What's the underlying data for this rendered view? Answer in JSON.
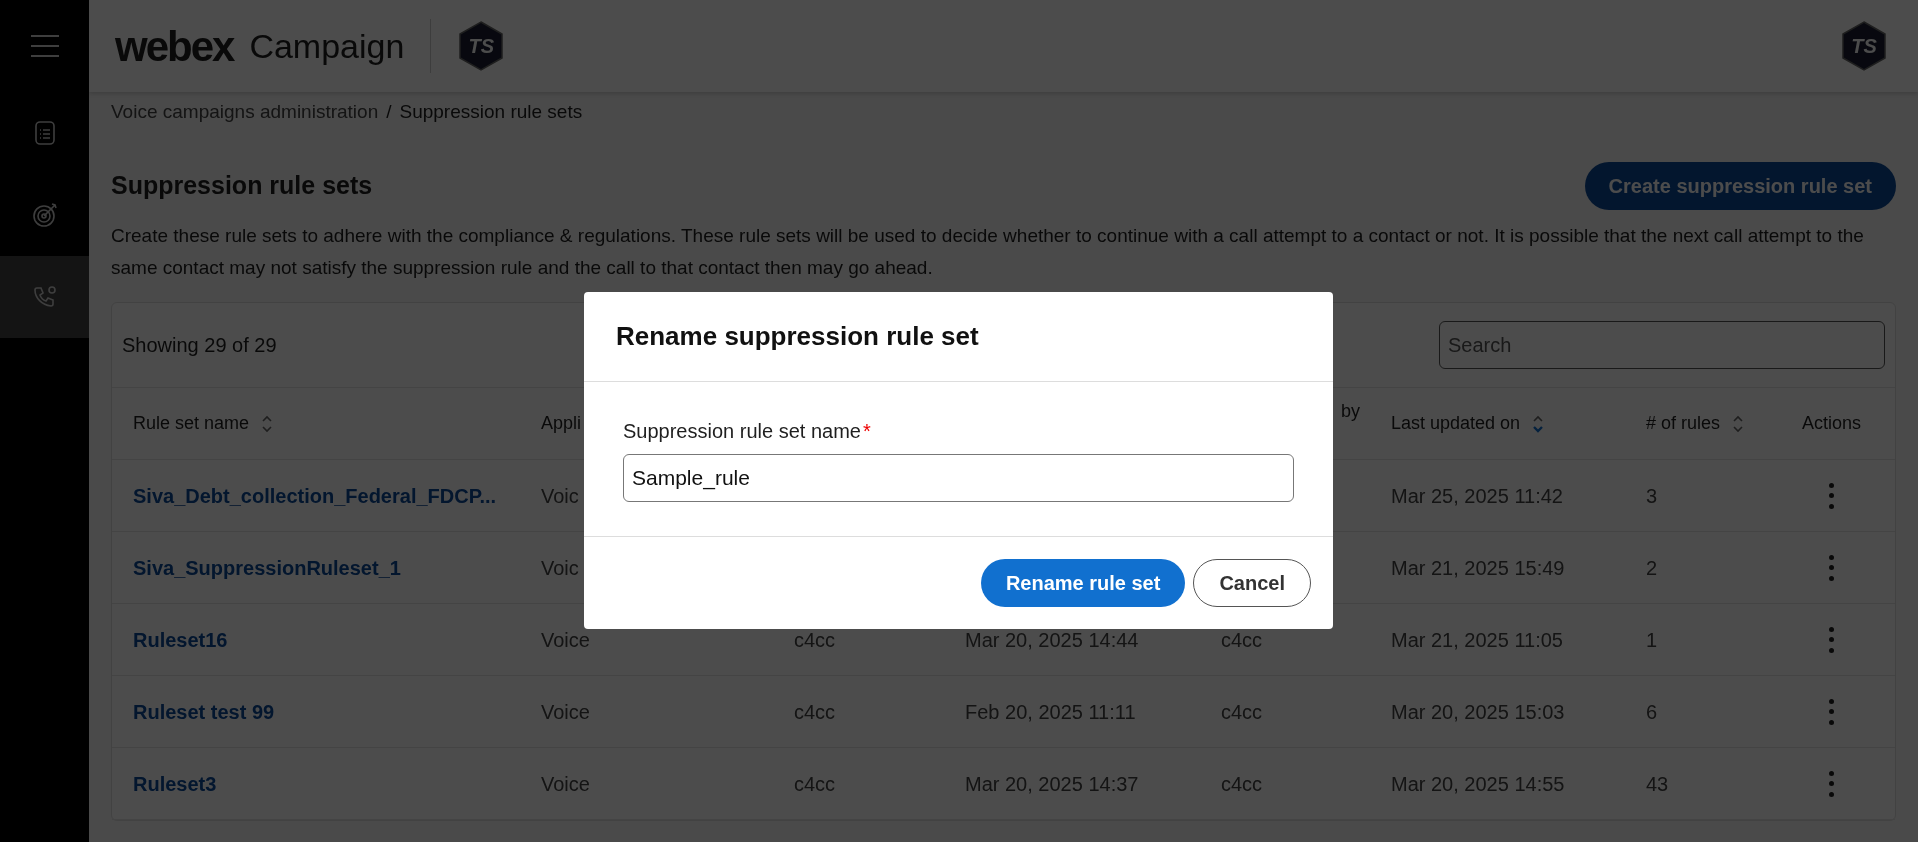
{
  "header": {
    "brand": "webex",
    "product": "Campaign",
    "logo_initials": "TS",
    "avatar_initials": "TS"
  },
  "sidebar": {
    "items": [
      {
        "kind": "list",
        "selected": false
      },
      {
        "kind": "target",
        "selected": false
      },
      {
        "kind": "phone",
        "selected": true
      }
    ]
  },
  "breadcrumb": {
    "parent": "Voice campaigns administration",
    "separator": "/",
    "current": "Suppression rule sets"
  },
  "page": {
    "title": "Suppression rule sets",
    "create_button": "Create suppression rule set",
    "description": "Create these rule sets to adhere with the compliance & regulations. These rule sets will be used to decide whether to continue with a call attempt to a contact or not. It is possible that the next call attempt to the same contact may not satisfy the suppression rule and the call to that contact then may go ahead."
  },
  "table": {
    "count": "Showing 29 of 29",
    "search": {
      "placeholder": "Search"
    },
    "columns": [
      {
        "label": "Rule set name",
        "sort_active": false
      },
      {
        "label": "Appli"
      },
      {},
      {},
      {
        "label": "by"
      },
      {
        "label": "Last updated on",
        "sort_active": true
      },
      {
        "label": "# of rules",
        "sort_active": false
      },
      {
        "label": "Actions"
      }
    ],
    "rows": [
      {
        "name": "Siva_Debt_collection_Federal_FDCP...",
        "application": "Voic",
        "last_updated": "Mar 25, 2025 11:42",
        "rules": "3"
      },
      {
        "name": "Siva_SuppressionRuleset_1",
        "application": "Voic",
        "last_updated": "Mar 21, 2025 15:49",
        "rules": "2"
      },
      {
        "name": "Ruleset16",
        "application": "Voice",
        "column_3": "c4cc",
        "column_4": "Mar 20, 2025 14:44",
        "column_5": "c4cc",
        "last_updated": "Mar 21, 2025 11:05",
        "rules": "1"
      },
      {
        "name": "Ruleset test 99",
        "application": "Voice",
        "column_3": "c4cc",
        "column_4": "Feb 20, 2025 11:11",
        "column_5": "c4cc",
        "last_updated": "Mar 20, 2025 15:03",
        "rules": "6"
      },
      {
        "name": "Ruleset3",
        "application": "Voice",
        "column_3": "c4cc",
        "column_4": "Mar 20, 2025 14:37",
        "column_5": "c4cc",
        "last_updated": "Mar 20, 2025 14:55",
        "rules": "43"
      }
    ]
  },
  "dialog": {
    "title": "Rename suppression rule set",
    "field_label": "Suppression rule set name",
    "required_mark": "*",
    "field_value": "Sample_rule",
    "primary_button": "Rename rule set",
    "cancel_button": "Cancel"
  }
}
